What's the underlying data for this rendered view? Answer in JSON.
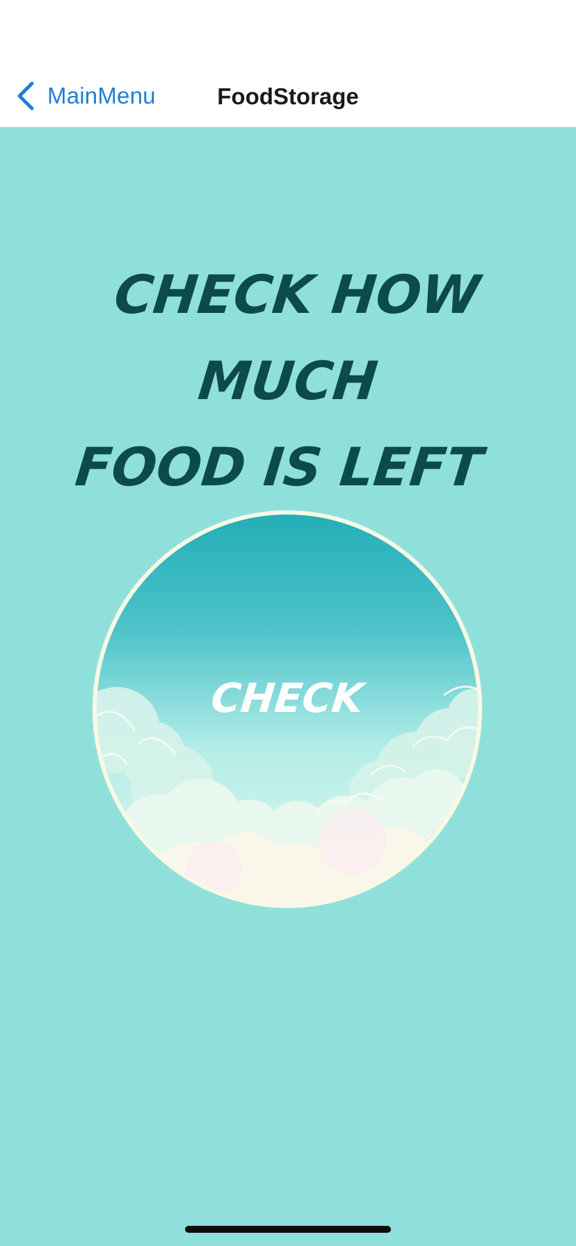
{
  "nav": {
    "back_label": "MainMenu",
    "title": "FoodStorage"
  },
  "main": {
    "headline_line1": "CHECK HOW MUCH",
    "headline_line2": "FOOD IS LEFT",
    "check_label": "CHECK"
  },
  "colors": {
    "background": "#8fe0db",
    "accent": "#1f7ed8",
    "headline": "#0c4b47"
  },
  "icons": {
    "back": "chevron-left-icon"
  }
}
